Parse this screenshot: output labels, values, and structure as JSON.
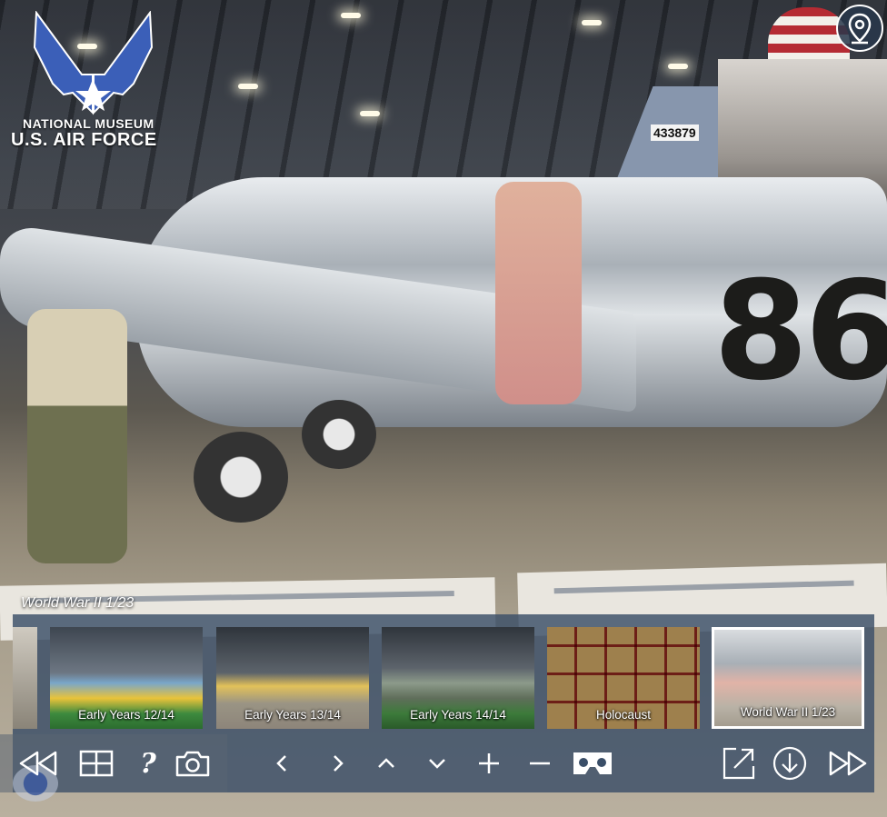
{
  "branding": {
    "line1": "NATIONAL MUSEUM",
    "line2": "U.S. AIR FORCE"
  },
  "scene": {
    "current_title": "World War II 1/23",
    "tail_number": "433879",
    "aircraft_number": "86"
  },
  "thumbnails": [
    {
      "label": "Early Years 12/14",
      "selected": false
    },
    {
      "label": "Early Years 13/14",
      "selected": false
    },
    {
      "label": "Early Years 14/14",
      "selected": false
    },
    {
      "label": "Holocaust",
      "selected": false
    },
    {
      "label": "World War II 1/23",
      "selected": true
    }
  ],
  "toolbar": {
    "help_label": "?",
    "buttons": [
      "rewind-icon",
      "grid-icon",
      "help-icon",
      "camera-icon",
      "chevron-left-icon",
      "chevron-right-icon",
      "chevron-up-icon",
      "chevron-down-icon",
      "zoom-in-icon",
      "zoom-out-icon",
      "vr-headset-icon",
      "fullscreen-icon",
      "download-icon",
      "fast-forward-icon"
    ]
  },
  "colors": {
    "panel": "#3a4e68",
    "icon": "#ffffff",
    "logo_blue": "#3b5fb8"
  }
}
